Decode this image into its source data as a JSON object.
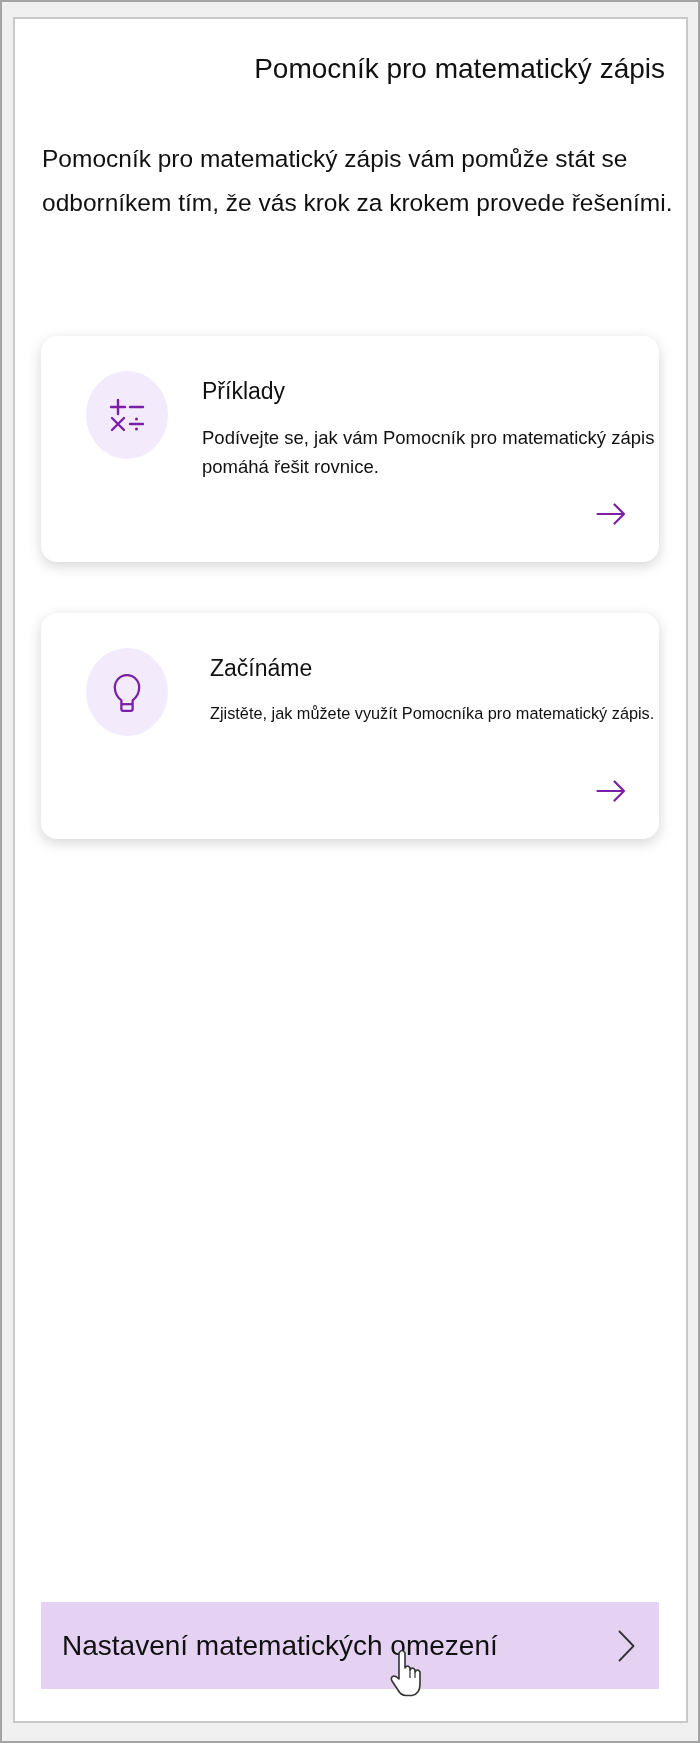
{
  "panel": {
    "title": "Pomocník pro matematický zápis",
    "intro": "Pomocník pro matematický zápis vám pomůže stát se odborníkem tím, že vás krok za krokem provede řešeními."
  },
  "cards": [
    {
      "kind": "examples",
      "title": "Příklady",
      "description": "Podívejte se, jak vám Pomocník pro matematický zápis pomáhá řešit rovnice."
    },
    {
      "kind": "intro",
      "title": "Začínáme",
      "description": "Zjistěte, jak můžete využít Pomocníka pro matematický zápis."
    }
  ],
  "settings_link": {
    "label": "Nastavení matematických omezení",
    "hovered": true
  }
}
